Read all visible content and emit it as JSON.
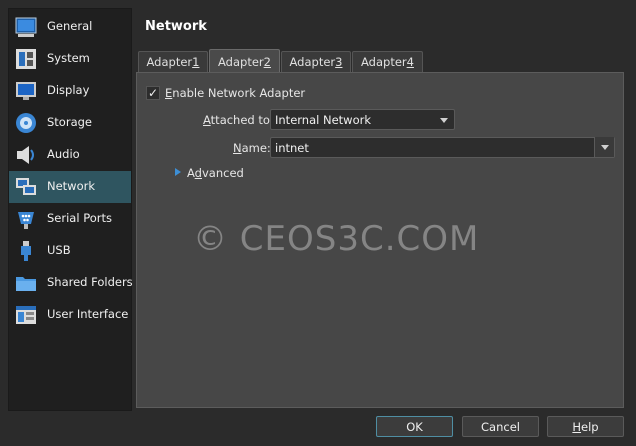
{
  "sidebar": {
    "items": [
      {
        "label": "General",
        "icon": "general-icon"
      },
      {
        "label": "System",
        "icon": "system-icon"
      },
      {
        "label": "Display",
        "icon": "display-icon"
      },
      {
        "label": "Storage",
        "icon": "storage-icon"
      },
      {
        "label": "Audio",
        "icon": "audio-icon"
      },
      {
        "label": "Network",
        "icon": "network-icon",
        "selected": true
      },
      {
        "label": "Serial Ports",
        "icon": "serial-ports-icon"
      },
      {
        "label": "USB",
        "icon": "usb-icon"
      },
      {
        "label": "Shared Folders",
        "icon": "shared-folders-icon"
      },
      {
        "label": "User Interface",
        "icon": "user-interface-icon"
      }
    ]
  },
  "page_title": "Network",
  "tabs": [
    {
      "label": "Adapter ",
      "num": "1"
    },
    {
      "label": "Adapter ",
      "num": "2",
      "active": true
    },
    {
      "label": "Adapter ",
      "num": "3"
    },
    {
      "label": "Adapter ",
      "num": "4"
    }
  ],
  "adapter": {
    "enable_checked": true,
    "enable_mark": "✓",
    "enable_label_u": "E",
    "enable_label_rest": "nable Network Adapter",
    "attached_label_u": "A",
    "attached_label_rest": "ttached to:",
    "attached_value": "Internal Network",
    "name_label_u": "N",
    "name_label_rest": "ame:",
    "name_value": "intnet",
    "advanced_label_u": "d",
    "advanced_label_pre": "A",
    "advanced_label_rest": "vanced"
  },
  "watermark": "© CEOS3C.COM",
  "buttons": {
    "ok": "OK",
    "cancel": "Cancel",
    "help_u": "H",
    "help_rest": "elp"
  },
  "colors": {
    "selected_item_bg": "#2f5560",
    "accent_blue": "#3d8fd6"
  }
}
